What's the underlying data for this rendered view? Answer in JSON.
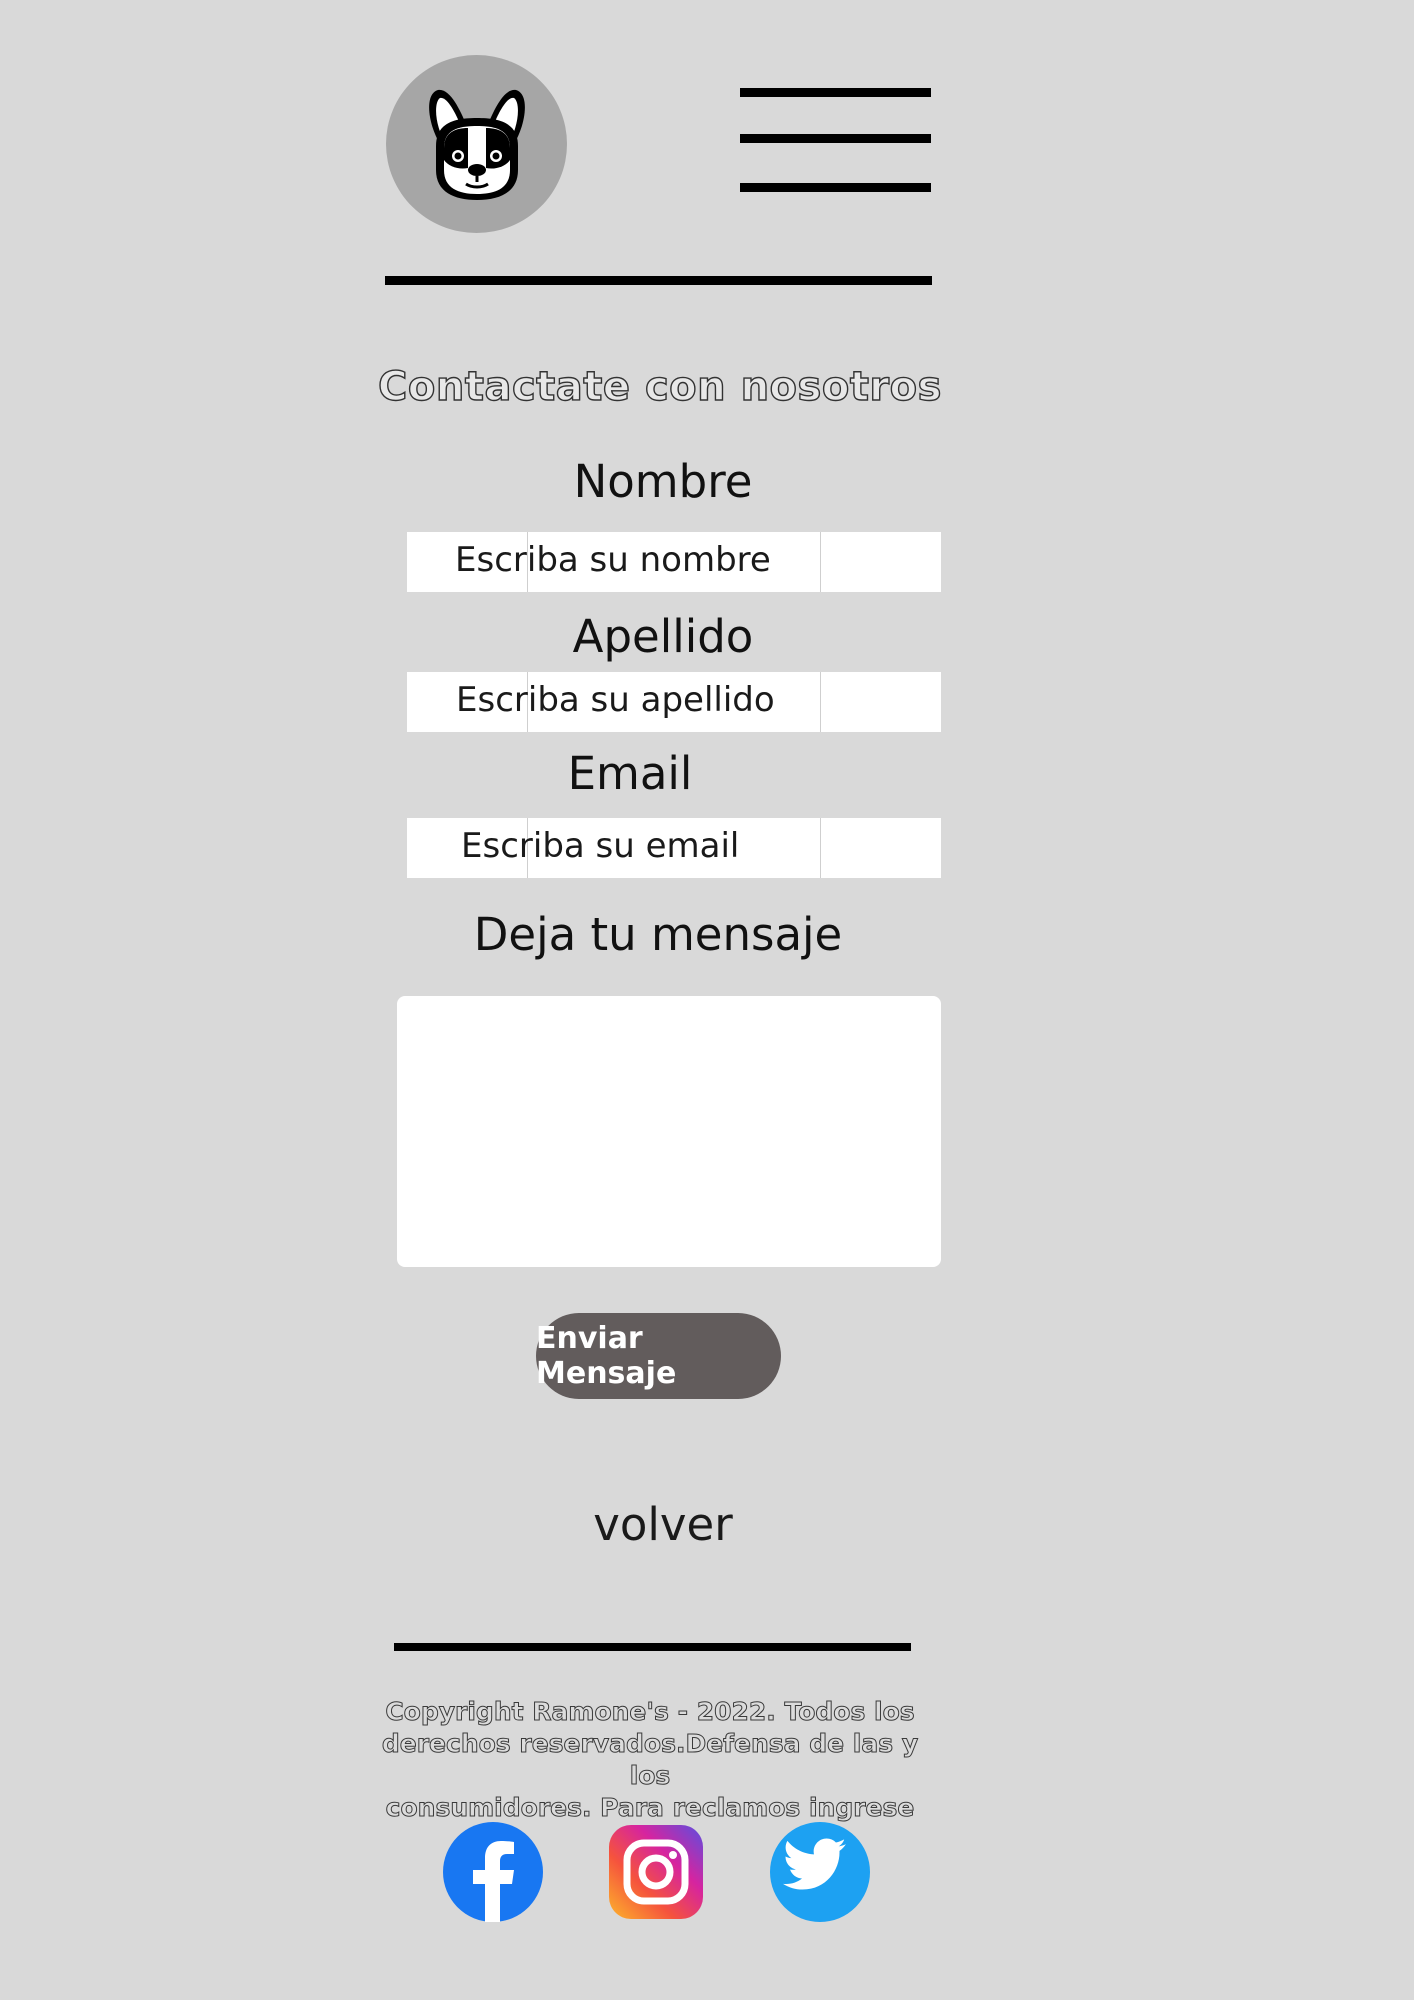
{
  "header": {
    "logo_icon": "french-bulldog-icon",
    "menu_icon": "hamburger-menu-icon"
  },
  "form": {
    "title": "Contactate con nosotros",
    "nombre_label": "Nombre",
    "nombre_placeholder": "Escriba su nombre",
    "apellido_label": "Apellido",
    "apellido_placeholder": "Escriba su apellido",
    "email_label": "Email",
    "email_placeholder": "Escriba su email",
    "message_label": "Deja tu mensaje",
    "message_value": "",
    "submit_label": "Enviar Mensaje"
  },
  "nav": {
    "back_label": "volver"
  },
  "footer": {
    "line1": "Copyright Ramone's - 2022. Todos los",
    "line2": "derechos reservados.Defensa de las y los",
    "line3": "consumidores. Para reclamos ingrese aquí",
    "social": [
      {
        "name": "facebook-icon",
        "color": "#1877f2"
      },
      {
        "name": "instagram-icon",
        "color": "#d6249f"
      },
      {
        "name": "twitter-icon",
        "color": "#1da1f2"
      }
    ]
  },
  "colors": {
    "background": "#d9d9d9",
    "logo_circle": "#a6a6a6",
    "button": "#625c5c"
  }
}
